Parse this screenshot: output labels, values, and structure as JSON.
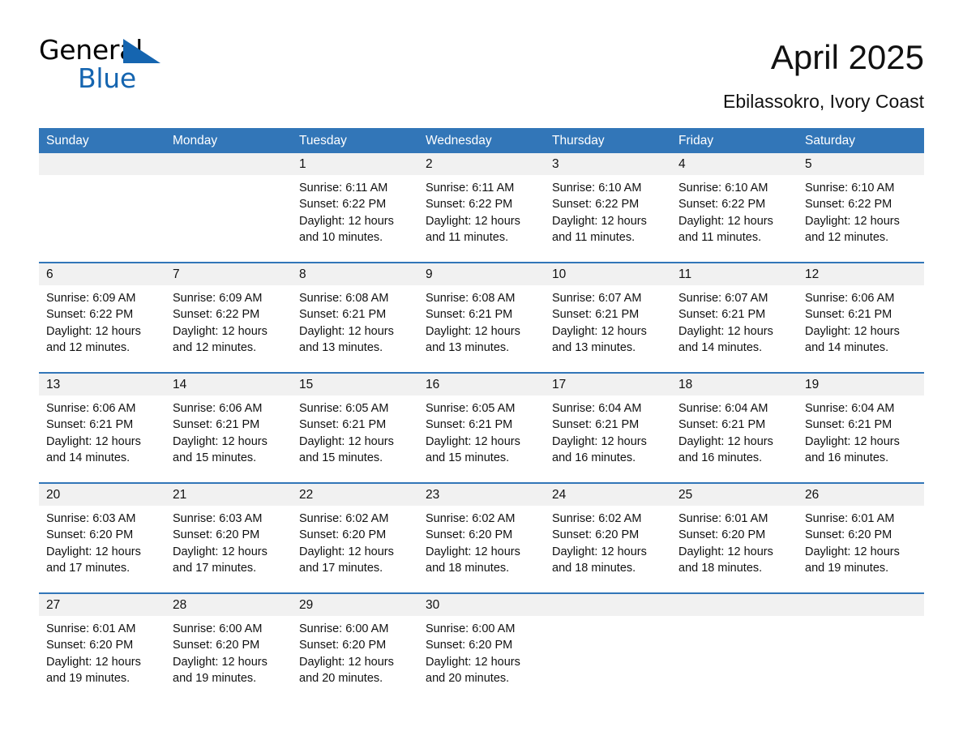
{
  "brand": {
    "name_part1": "General",
    "name_part2": "Blue",
    "accent_color": "#1565b0",
    "triangle_icon": "triangle-icon"
  },
  "header": {
    "month_title": "April 2025",
    "location": "Ebilassokro, Ivory Coast"
  },
  "calendar": {
    "header_bg": "#3276b8",
    "daynum_bg": "#f1f1f1",
    "weekdays": [
      "Sunday",
      "Monday",
      "Tuesday",
      "Wednesday",
      "Thursday",
      "Friday",
      "Saturday"
    ],
    "weeks": [
      {
        "days": [
          {
            "num": "",
            "lines": []
          },
          {
            "num": "",
            "lines": []
          },
          {
            "num": "1",
            "lines": [
              "Sunrise: 6:11 AM",
              "Sunset: 6:22 PM",
              "Daylight: 12 hours",
              "and 10 minutes."
            ]
          },
          {
            "num": "2",
            "lines": [
              "Sunrise: 6:11 AM",
              "Sunset: 6:22 PM",
              "Daylight: 12 hours",
              "and 11 minutes."
            ]
          },
          {
            "num": "3",
            "lines": [
              "Sunrise: 6:10 AM",
              "Sunset: 6:22 PM",
              "Daylight: 12 hours",
              "and 11 minutes."
            ]
          },
          {
            "num": "4",
            "lines": [
              "Sunrise: 6:10 AM",
              "Sunset: 6:22 PM",
              "Daylight: 12 hours",
              "and 11 minutes."
            ]
          },
          {
            "num": "5",
            "lines": [
              "Sunrise: 6:10 AM",
              "Sunset: 6:22 PM",
              "Daylight: 12 hours",
              "and 12 minutes."
            ]
          }
        ]
      },
      {
        "days": [
          {
            "num": "6",
            "lines": [
              "Sunrise: 6:09 AM",
              "Sunset: 6:22 PM",
              "Daylight: 12 hours",
              "and 12 minutes."
            ]
          },
          {
            "num": "7",
            "lines": [
              "Sunrise: 6:09 AM",
              "Sunset: 6:22 PM",
              "Daylight: 12 hours",
              "and 12 minutes."
            ]
          },
          {
            "num": "8",
            "lines": [
              "Sunrise: 6:08 AM",
              "Sunset: 6:21 PM",
              "Daylight: 12 hours",
              "and 13 minutes."
            ]
          },
          {
            "num": "9",
            "lines": [
              "Sunrise: 6:08 AM",
              "Sunset: 6:21 PM",
              "Daylight: 12 hours",
              "and 13 minutes."
            ]
          },
          {
            "num": "10",
            "lines": [
              "Sunrise: 6:07 AM",
              "Sunset: 6:21 PM",
              "Daylight: 12 hours",
              "and 13 minutes."
            ]
          },
          {
            "num": "11",
            "lines": [
              "Sunrise: 6:07 AM",
              "Sunset: 6:21 PM",
              "Daylight: 12 hours",
              "and 14 minutes."
            ]
          },
          {
            "num": "12",
            "lines": [
              "Sunrise: 6:06 AM",
              "Sunset: 6:21 PM",
              "Daylight: 12 hours",
              "and 14 minutes."
            ]
          }
        ]
      },
      {
        "days": [
          {
            "num": "13",
            "lines": [
              "Sunrise: 6:06 AM",
              "Sunset: 6:21 PM",
              "Daylight: 12 hours",
              "and 14 minutes."
            ]
          },
          {
            "num": "14",
            "lines": [
              "Sunrise: 6:06 AM",
              "Sunset: 6:21 PM",
              "Daylight: 12 hours",
              "and 15 minutes."
            ]
          },
          {
            "num": "15",
            "lines": [
              "Sunrise: 6:05 AM",
              "Sunset: 6:21 PM",
              "Daylight: 12 hours",
              "and 15 minutes."
            ]
          },
          {
            "num": "16",
            "lines": [
              "Sunrise: 6:05 AM",
              "Sunset: 6:21 PM",
              "Daylight: 12 hours",
              "and 15 minutes."
            ]
          },
          {
            "num": "17",
            "lines": [
              "Sunrise: 6:04 AM",
              "Sunset: 6:21 PM",
              "Daylight: 12 hours",
              "and 16 minutes."
            ]
          },
          {
            "num": "18",
            "lines": [
              "Sunrise: 6:04 AM",
              "Sunset: 6:21 PM",
              "Daylight: 12 hours",
              "and 16 minutes."
            ]
          },
          {
            "num": "19",
            "lines": [
              "Sunrise: 6:04 AM",
              "Sunset: 6:21 PM",
              "Daylight: 12 hours",
              "and 16 minutes."
            ]
          }
        ]
      },
      {
        "days": [
          {
            "num": "20",
            "lines": [
              "Sunrise: 6:03 AM",
              "Sunset: 6:20 PM",
              "Daylight: 12 hours",
              "and 17 minutes."
            ]
          },
          {
            "num": "21",
            "lines": [
              "Sunrise: 6:03 AM",
              "Sunset: 6:20 PM",
              "Daylight: 12 hours",
              "and 17 minutes."
            ]
          },
          {
            "num": "22",
            "lines": [
              "Sunrise: 6:02 AM",
              "Sunset: 6:20 PM",
              "Daylight: 12 hours",
              "and 17 minutes."
            ]
          },
          {
            "num": "23",
            "lines": [
              "Sunrise: 6:02 AM",
              "Sunset: 6:20 PM",
              "Daylight: 12 hours",
              "and 18 minutes."
            ]
          },
          {
            "num": "24",
            "lines": [
              "Sunrise: 6:02 AM",
              "Sunset: 6:20 PM",
              "Daylight: 12 hours",
              "and 18 minutes."
            ]
          },
          {
            "num": "25",
            "lines": [
              "Sunrise: 6:01 AM",
              "Sunset: 6:20 PM",
              "Daylight: 12 hours",
              "and 18 minutes."
            ]
          },
          {
            "num": "26",
            "lines": [
              "Sunrise: 6:01 AM",
              "Sunset: 6:20 PM",
              "Daylight: 12 hours",
              "and 19 minutes."
            ]
          }
        ]
      },
      {
        "days": [
          {
            "num": "27",
            "lines": [
              "Sunrise: 6:01 AM",
              "Sunset: 6:20 PM",
              "Daylight: 12 hours",
              "and 19 minutes."
            ]
          },
          {
            "num": "28",
            "lines": [
              "Sunrise: 6:00 AM",
              "Sunset: 6:20 PM",
              "Daylight: 12 hours",
              "and 19 minutes."
            ]
          },
          {
            "num": "29",
            "lines": [
              "Sunrise: 6:00 AM",
              "Sunset: 6:20 PM",
              "Daylight: 12 hours",
              "and 20 minutes."
            ]
          },
          {
            "num": "30",
            "lines": [
              "Sunrise: 6:00 AM",
              "Sunset: 6:20 PM",
              "Daylight: 12 hours",
              "and 20 minutes."
            ]
          },
          {
            "num": "",
            "lines": []
          },
          {
            "num": "",
            "lines": []
          },
          {
            "num": "",
            "lines": []
          }
        ]
      }
    ]
  }
}
